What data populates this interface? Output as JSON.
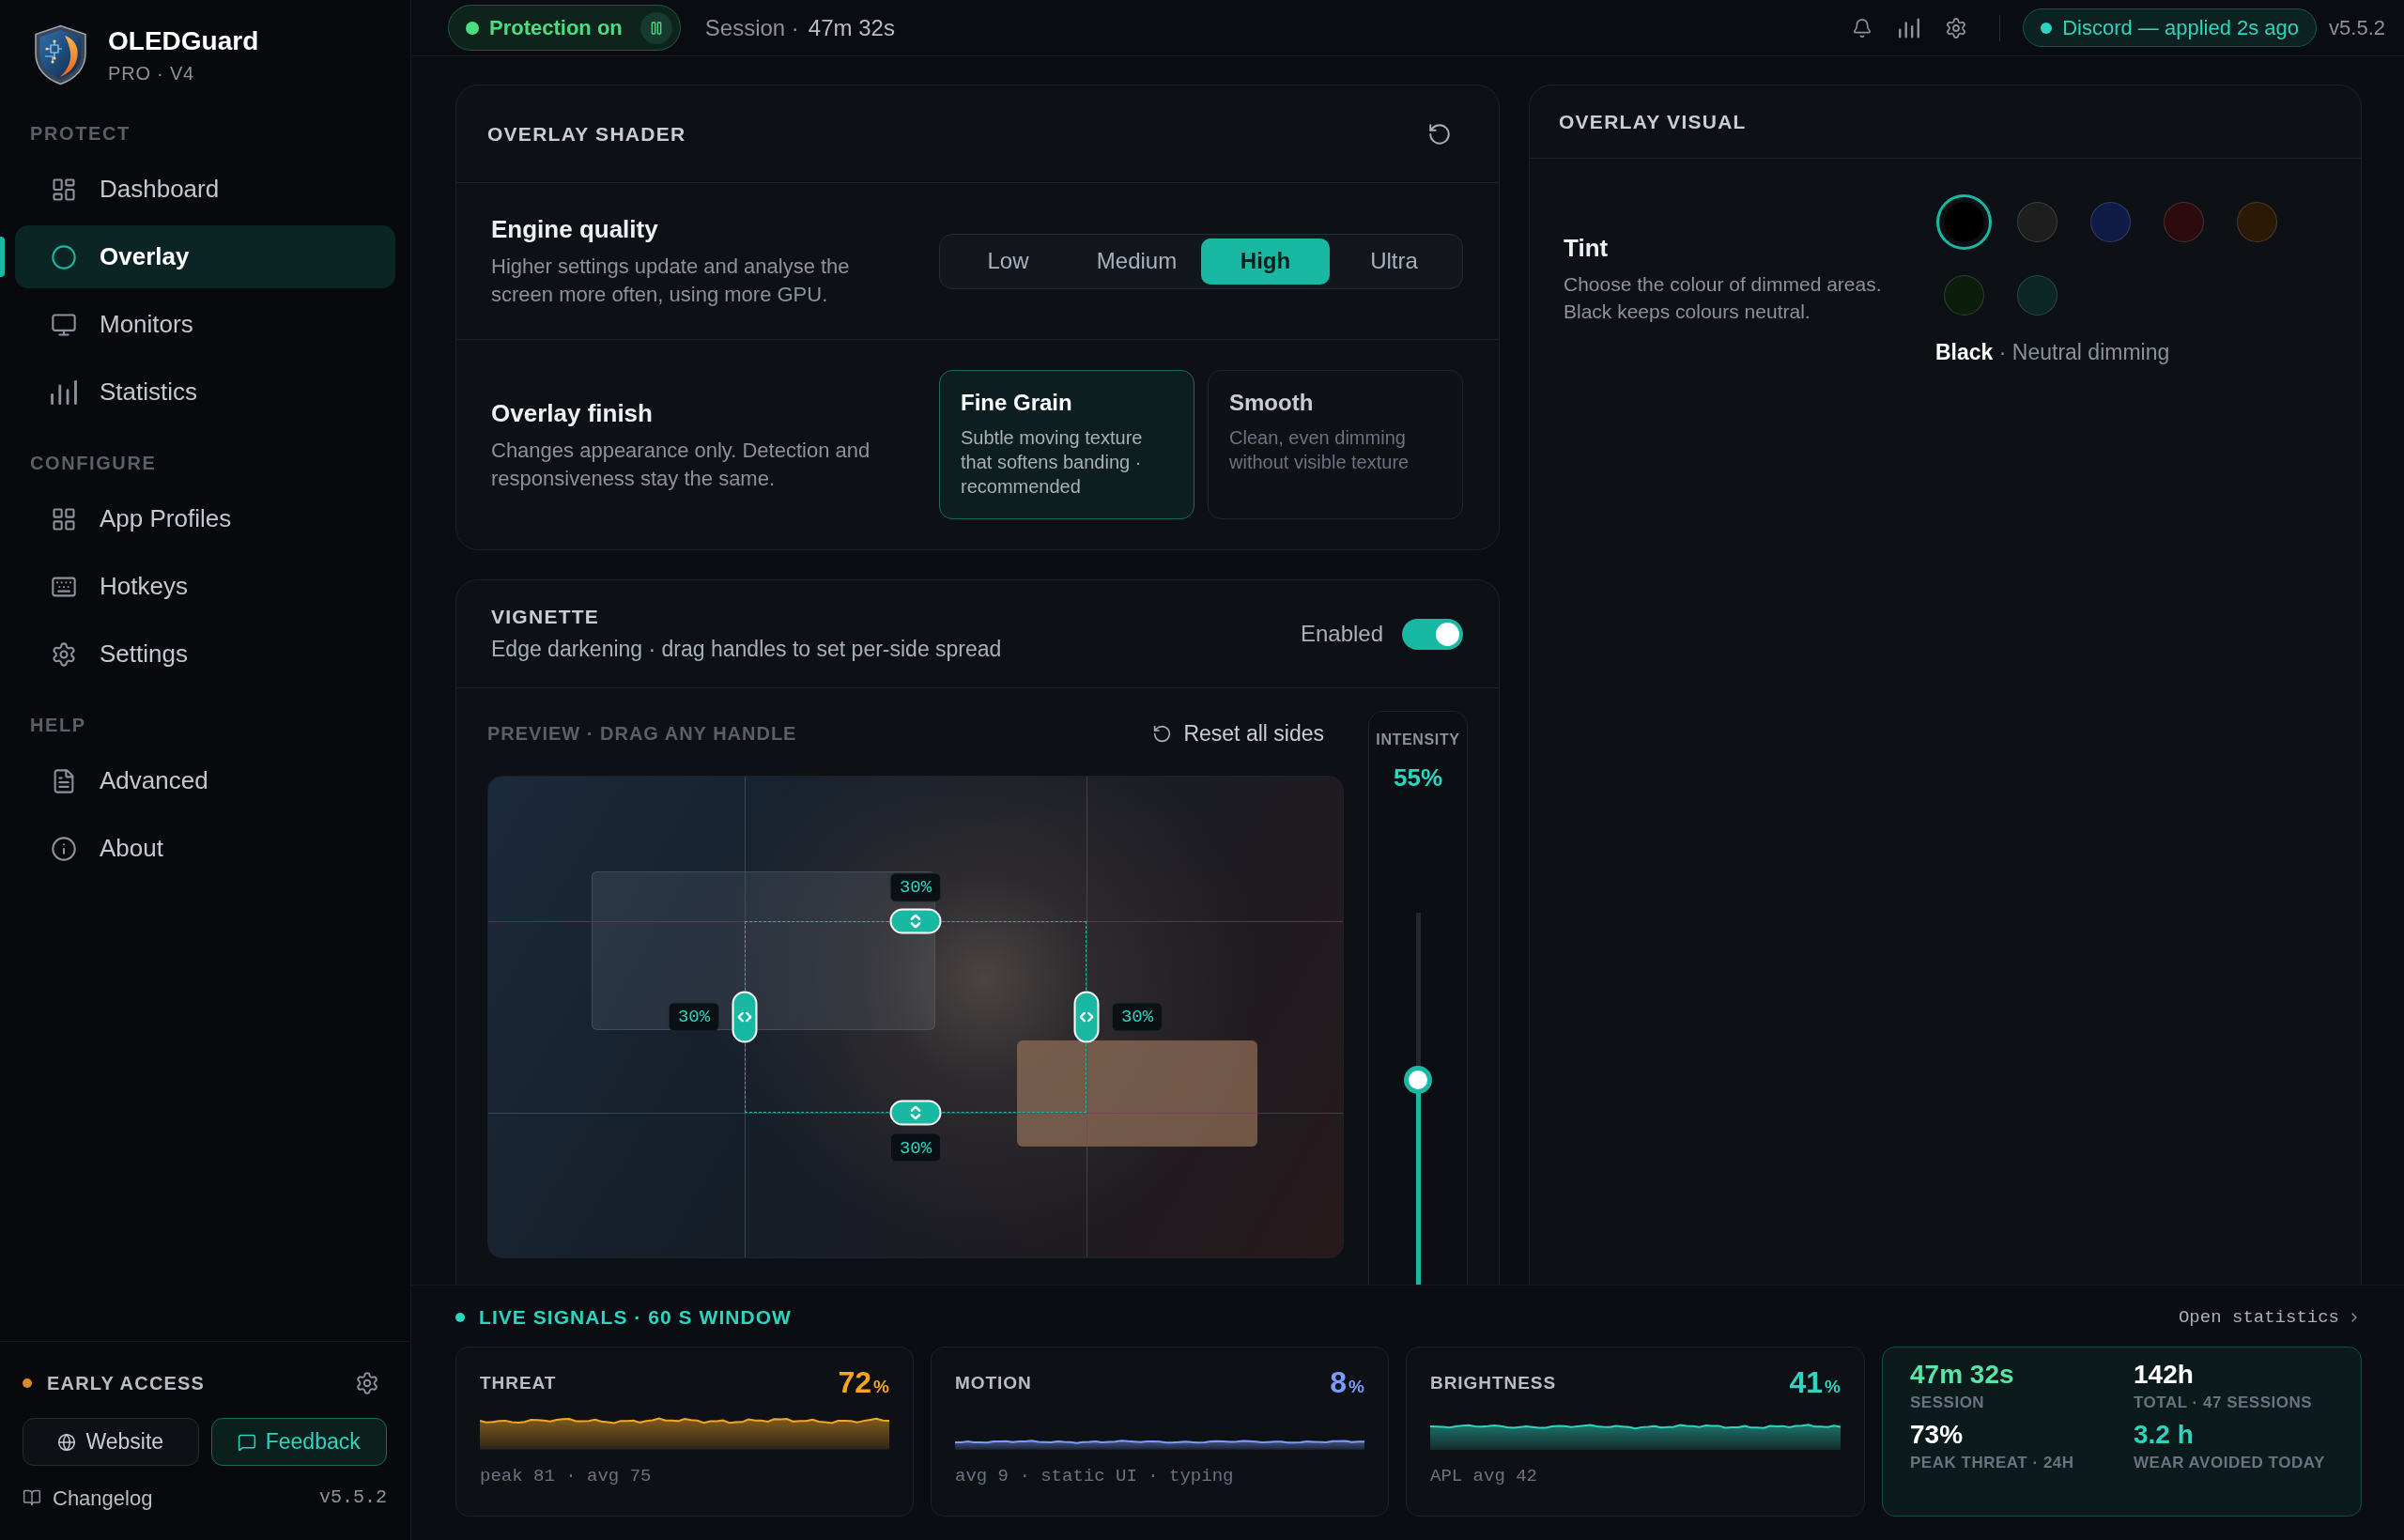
{
  "sidebar": {
    "app": {
      "name": "OLEDGuard",
      "edition": "PRO · V4"
    },
    "sections": [
      {
        "title": "PROTECT",
        "items": [
          {
            "label": "Dashboard",
            "selected": false
          },
          {
            "label": "Overlay",
            "selected": true
          },
          {
            "label": "Monitors",
            "selected": false
          },
          {
            "label": "Statistics",
            "selected": false
          }
        ]
      },
      {
        "title": "CONFIGURE",
        "items": [
          {
            "label": "App Profiles",
            "selected": false
          },
          {
            "label": "Hotkeys",
            "selected": false
          },
          {
            "label": "Settings",
            "selected": false
          }
        ]
      },
      {
        "title": "HELP",
        "items": [
          {
            "label": "Advanced",
            "selected": false
          },
          {
            "label": "About",
            "selected": false
          }
        ]
      }
    ],
    "footer": {
      "badge": "EARLY ACCESS",
      "buttons": [
        {
          "label": "Website",
          "kind": "plain"
        },
        {
          "label": "Feedback",
          "kind": "accent"
        }
      ],
      "changelog": "Changelog",
      "version": "v5.5.2"
    }
  },
  "top_bar": {
    "protection": {
      "label": "Protection on",
      "on": true
    },
    "session": {
      "label": "Session ·",
      "value": "47m 32s"
    },
    "status": "Discord — applied 2s ago",
    "version": "v5.5.2"
  },
  "overlay_shader": {
    "title": "OVERLAY SHADER",
    "engine_quality": {
      "title": "Engine quality",
      "description": "Higher settings update and analyse the screen more often, using more GPU.",
      "options": [
        {
          "label": "Low",
          "selected": false
        },
        {
          "label": "Medium",
          "selected": false
        },
        {
          "label": "High",
          "selected": true
        },
        {
          "label": "Ultra",
          "selected": false
        }
      ]
    },
    "overlay_finish": {
      "title": "Overlay finish",
      "description": "Changes appearance only. Detection and responsiveness stay the same.",
      "options": [
        {
          "title": "Fine Grain",
          "description": "Subtle moving texture that softens banding · recommended",
          "selected": true
        },
        {
          "title": "Smooth",
          "description": "Clean, even dimming without visible texture",
          "selected": false
        }
      ]
    }
  },
  "vignette": {
    "title": "VIGNETTE",
    "description": "Edge darkening · drag handles to set per-side spread",
    "toggle": {
      "label": "Enabled",
      "on": true
    },
    "preview": {
      "title": "PREVIEW · DRAG ANY HANDLE",
      "reset": "Reset all sides",
      "handles": [
        {
          "kind": "top",
          "label": "30%"
        },
        {
          "kind": "left",
          "label": "30%"
        },
        {
          "kind": "right",
          "label": "30%"
        },
        {
          "kind": "bottom",
          "label": "30%"
        }
      ],
      "intensity": {
        "label": "INTENSITY",
        "value": "55%",
        "level": 0.55
      }
    }
  },
  "overlay_visual": {
    "title": "OVERLAY VISUAL",
    "tint": {
      "title": "Tint",
      "description": "Choose the colour of dimmed areas. Black keeps colours neutral.",
      "swatches": [
        {
          "color": "#000000",
          "selected": true
        },
        {
          "color": "#1e1e1f",
          "selected": false
        },
        {
          "color": "#0f1c46",
          "selected": false
        },
        {
          "color": "#2b0b0e",
          "selected": false
        },
        {
          "color": "#2c1905",
          "selected": false
        },
        {
          "color": "#0b1e0b",
          "selected": false
        },
        {
          "color": "#0b2623",
          "selected": false
        }
      ],
      "selection": "**Black** · Neutral dimming"
    }
  },
  "live_signals": {
    "title": "LIVE SIGNALS · 60 S WINDOW",
    "link": "Open statistics",
    "signals": [
      {
        "name": "THREAT",
        "value": "72",
        "unit": "%",
        "color": "#f5a524",
        "details": "peak 81 · avg 75"
      },
      {
        "name": "MOTION",
        "value": "8",
        "unit": "%",
        "color": "#7b9cff",
        "details": "avg 9 · static UI · typing"
      },
      {
        "name": "BRIGHTNESS",
        "value": "41",
        "unit": "%",
        "color": "#2dd4bf",
        "details": "APL avg 42"
      }
    ],
    "summary": [
      {
        "value": "47m 32s",
        "label": "SESSION",
        "color": "#5be3a6"
      },
      {
        "value": "142h",
        "label": "TOTAL · 47 SESSIONS",
        "color": "#ffffff"
      },
      {
        "value": "73%",
        "label": "PEAK THREAT · 24H",
        "color": "#ffffff"
      },
      {
        "value": "3.2 h",
        "label": "WEAR AVOIDED TODAY",
        "color": "#2dd4bf"
      }
    ]
  }
}
